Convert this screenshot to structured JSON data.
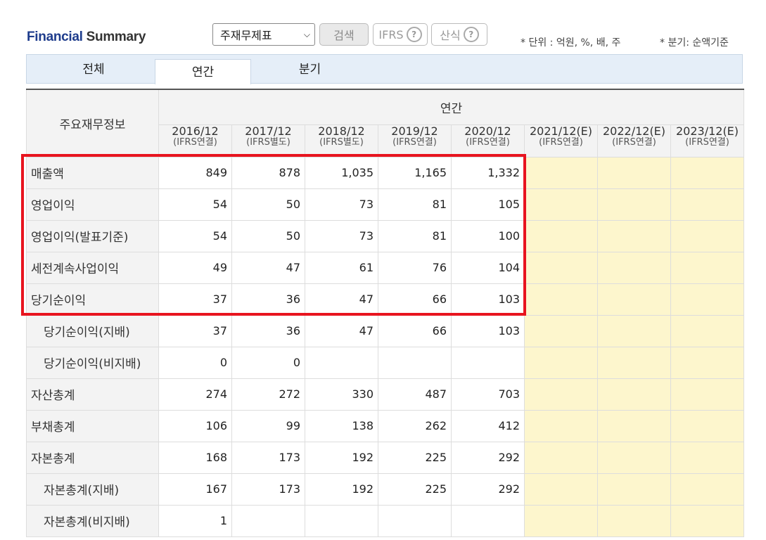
{
  "header": {
    "title_part1": "Financial",
    "title_part2": " Summary",
    "select_value": "주재무제표",
    "search_label": "검색",
    "ifrs_label": "IFRS",
    "formula_label": "산식",
    "unit_note": "* 단위 : 억원, %, 배, 주",
    "quarter_note": "* 분기: 순액기준"
  },
  "tabs": [
    "전체",
    "연간",
    "분기"
  ],
  "table": {
    "corner_label": "주요재무정보",
    "group_label": "연간",
    "years": [
      {
        "period": "2016/12",
        "basis": "(IFRS연결)"
      },
      {
        "period": "2017/12",
        "basis": "(IFRS별도)"
      },
      {
        "period": "2018/12",
        "basis": "(IFRS별도)"
      },
      {
        "period": "2019/12",
        "basis": "(IFRS연결)"
      },
      {
        "period": "2020/12",
        "basis": "(IFRS연결)"
      },
      {
        "period": "2021/12(E)",
        "basis": "(IFRS연결)"
      },
      {
        "period": "2022/12(E)",
        "basis": "(IFRS연결)"
      },
      {
        "period": "2023/12(E)",
        "basis": "(IFRS연결)"
      }
    ],
    "rows": [
      {
        "label": "매출액",
        "values": [
          "849",
          "878",
          "1,035",
          "1,165",
          "1,332"
        ]
      },
      {
        "label": "영업이익",
        "values": [
          "54",
          "50",
          "73",
          "81",
          "105"
        ]
      },
      {
        "label": "영업이익(발표기준)",
        "values": [
          "54",
          "50",
          "73",
          "81",
          "100"
        ]
      },
      {
        "label": "세전계속사업이익",
        "values": [
          "49",
          "47",
          "61",
          "76",
          "104"
        ]
      },
      {
        "label": "당기순이익",
        "values": [
          "37",
          "36",
          "47",
          "66",
          "103"
        ]
      },
      {
        "label": "당기순이익(지배)",
        "values": [
          "37",
          "36",
          "47",
          "66",
          "103"
        ]
      },
      {
        "label": "당기순이익(비지배)",
        "values": [
          "0",
          "0",
          "",
          "",
          ""
        ]
      },
      {
        "label": "자산총계",
        "values": [
          "274",
          "272",
          "330",
          "487",
          "703"
        ]
      },
      {
        "label": "부채총계",
        "values": [
          "106",
          "99",
          "138",
          "262",
          "412"
        ]
      },
      {
        "label": "자본총계",
        "values": [
          "168",
          "173",
          "192",
          "225",
          "292"
        ]
      },
      {
        "label": "자본총계(지배)",
        "values": [
          "167",
          "173",
          "192",
          "225",
          "292"
        ]
      },
      {
        "label": "자본총계(비지배)",
        "values": [
          "1",
          "",
          "",
          "",
          ""
        ]
      }
    ]
  },
  "colors": {
    "brand": "#1e3c8c",
    "highlight": "#e8141f",
    "estimate_bg": "#fdf6cd",
    "tab_bg": "#e5eef8"
  }
}
